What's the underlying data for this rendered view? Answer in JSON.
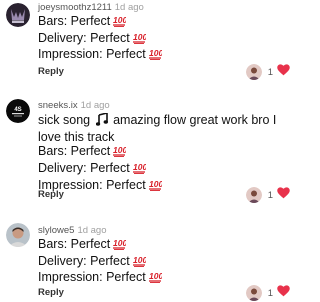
{
  "comments": [
    {
      "username": "joeysmoothz1211",
      "time": "1d ago",
      "lines": [
        "Bars: Perfect",
        "Delivery: Perfect",
        "Impression: Perfect"
      ],
      "reply_label": "Reply",
      "like_count": "1",
      "avatar": "team-logo-avatar"
    },
    {
      "username": "sneeks.ix",
      "time": "1d ago",
      "text_a": "sick song",
      "text_b": "amazing flow great work bro I love this track",
      "lines": [
        "Bars: Perfect",
        "Delivery: Perfect",
        "Impression: Perfect"
      ],
      "reply_label": "Reply",
      "like_count": "1",
      "avatar": "dark-logo-avatar"
    },
    {
      "username": "slylowe5",
      "time": "1d ago",
      "lines": [
        "Bars: Perfect",
        "Delivery: Perfect",
        "Impression: Perfect"
      ],
      "reply_label": "Reply",
      "like_count": "1",
      "avatar": "photo-avatar"
    }
  ],
  "icons": {
    "hundred": "hundred-points-emoji",
    "note": "musical-note-emoji",
    "heart": "heart-icon",
    "liker": "liker-avatar"
  },
  "colors": {
    "heart": "#e8324b",
    "hundred": "#d8202a",
    "username": "#555555",
    "timestamp": "#a0a0a0"
  }
}
